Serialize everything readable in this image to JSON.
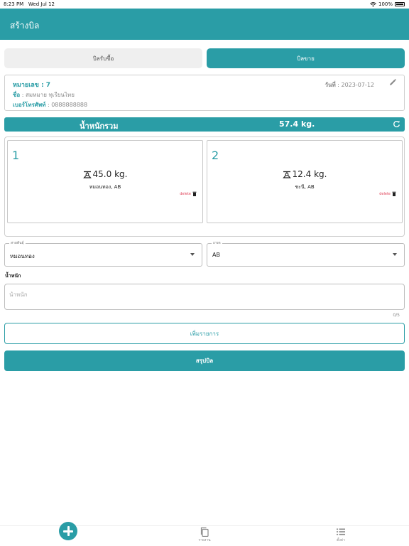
{
  "status_bar": {
    "time": "8:23 PM",
    "date": "Wed Jul 12",
    "battery": "100%"
  },
  "app_bar": {
    "title": "สร้างบิล"
  },
  "tabs": [
    {
      "label": "บิลรับซื้อ",
      "active": false
    },
    {
      "label": "บิลขาย",
      "active": true
    }
  ],
  "bill_info": {
    "number_label": "หมายเลข : 7",
    "name_label": "ชื่อ",
    "name_value": " : สมหมาย ทุเรียนไทย",
    "phone_label": "เบอร์โทรศัพท์",
    "phone_value": " : 0888888888",
    "date_label": "วันที่",
    "date_value": " : 2023-07-12"
  },
  "total": {
    "label": "น้ำหนักรวม",
    "value": "57.4 kg."
  },
  "items": [
    {
      "index": "1",
      "weight": "45.0 kg.",
      "desc": "หมอนทอง, AB",
      "delete_label": "delete"
    },
    {
      "index": "2",
      "weight": "12.4 kg.",
      "desc": "ชะนี, AB",
      "delete_label": "delete"
    }
  ],
  "form": {
    "type_label": "สายพันธุ์",
    "type_value": "หมอนทอง",
    "grade_label": "เกรด",
    "grade_value": "AB",
    "weight_title": "น้ำหนัก",
    "weight_placeholder": "น้ำหนัก",
    "weight_value": "",
    "counter": "0/5"
  },
  "buttons": {
    "add": "เพิ่มรายการ",
    "summary": "สรุปบิล"
  },
  "bottom_nav": {
    "report_label": "รายงาน",
    "settings_label": "ตั้งค่า"
  },
  "colors": {
    "primary": "#2a9da6",
    "delete": "#e0445a",
    "tab_inactive": "#efefef"
  }
}
